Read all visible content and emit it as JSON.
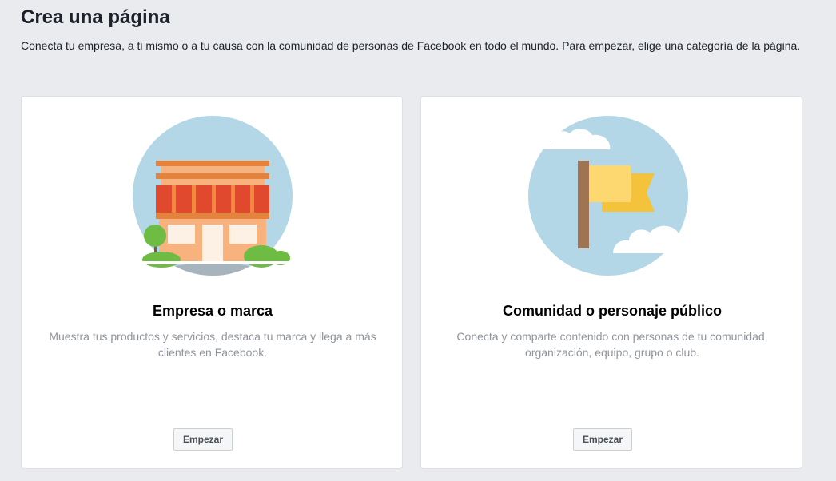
{
  "page": {
    "title": "Crea una página",
    "subtitle": "Conecta tu empresa, a ti mismo o a tu causa con la comunidad de personas de Facebook en todo el mundo. Para empezar, elige una categoría de la página."
  },
  "cards": [
    {
      "title": "Empresa o marca",
      "description": "Muestra tus productos y servicios, destaca tu marca y llega a más clientes en Facebook.",
      "button_label": "Empezar",
      "illustration": "storefront-icon"
    },
    {
      "title": "Comunidad o personaje público",
      "description": "Conecta y comparte contenido con personas de tu comunidad, organización, equipo, grupo o club.",
      "button_label": "Empezar",
      "illustration": "flag-icon"
    }
  ],
  "colors": {
    "background": "#e9ebee",
    "card": "#ffffff",
    "sky": "#b3d7e6",
    "awning": "#e0492e",
    "roof": "#e3833e",
    "wall": "#f8b27d",
    "tree": "#6ebc44",
    "flag": "#fdd871",
    "flag_back": "#f5c33b",
    "pole": "#a07352"
  }
}
